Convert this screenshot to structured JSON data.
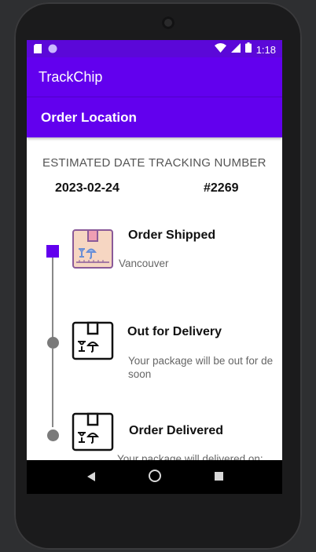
{
  "status_bar": {
    "time": "1:18",
    "icons": [
      "sd-card-icon",
      "circle-icon",
      "wifi-icon",
      "signal-icon",
      "battery-icon"
    ]
  },
  "app_bar": {
    "title": "TrackChip"
  },
  "sub_bar": {
    "title": "Order Location"
  },
  "summary": {
    "estimated_date_label": "ESTIMATED DATE",
    "tracking_number_label": "TRACKING NUMBER",
    "estimated_date": "2023-02-24",
    "tracking_number": "#2269"
  },
  "steps": [
    {
      "title": "Order Shipped",
      "description": "Vancouver",
      "state": "active",
      "icon": "package-icon-colored"
    },
    {
      "title": "Out for Delivery",
      "description": "Your package will be out for de soon",
      "state": "pending",
      "icon": "package-icon"
    },
    {
      "title": "Order Delivered",
      "description": "Your package will delivered on:",
      "state": "pending",
      "icon": "package-icon"
    }
  ],
  "nav": {
    "buttons": [
      "back",
      "home",
      "recents"
    ]
  },
  "colors": {
    "primary": "#6200ee",
    "status_bar": "#5b08d8",
    "timeline_dot": "#7a7a7a",
    "navbar": "#000000"
  }
}
